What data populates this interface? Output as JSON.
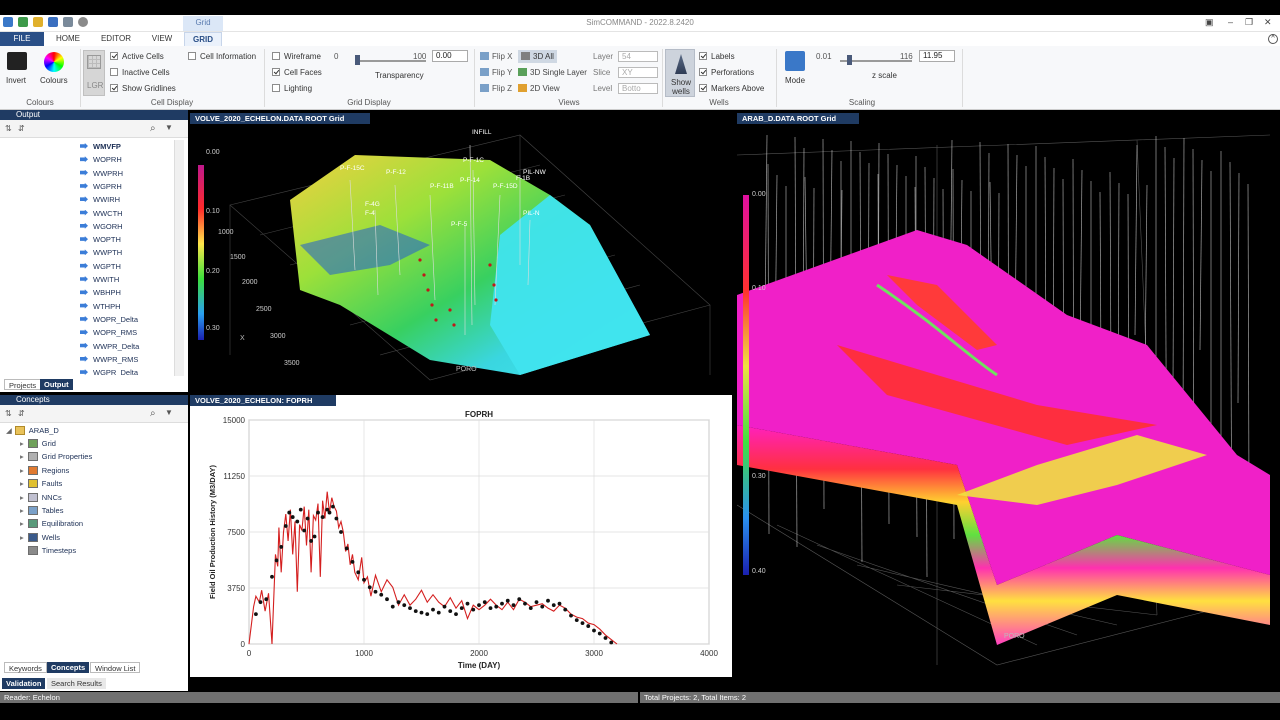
{
  "window": {
    "title": "SimCOMMAND - 2022.8.2420",
    "context_tab": "Grid"
  },
  "tabs": [
    "FILE",
    "HOME",
    "EDITOR",
    "VIEW",
    "GRID"
  ],
  "ribbon": {
    "colours": {
      "invert": "Invert",
      "colours": "Colours",
      "group": "Colours"
    },
    "cell_display": {
      "lgr": "LGR",
      "active": "Active Cells",
      "inactive": "Inactive Cells",
      "gridlines": "Show Gridlines",
      "info": "Cell Information",
      "group": "Cell Display"
    },
    "grid_display": {
      "wireframe": "Wireframe",
      "faces": "Cell Faces",
      "lighting": "Lighting",
      "min": "0",
      "max": "100",
      "value": "0.00",
      "transparency": "Transparency",
      "group": "Grid Display"
    },
    "views": {
      "flipx": "Flip X",
      "flipy": "Flip Y",
      "flipz": "Flip Z",
      "all3d": "3D All",
      "single3d": "3D Single Layer",
      "view2d": "2D View",
      "layer": "Layer",
      "slice": "Slice",
      "level": "Level",
      "layer_val": "54",
      "slice_val": "XY",
      "level_val": "Botto",
      "group": "Views"
    },
    "wells": {
      "show": "Show wells",
      "labels": "Labels",
      "perfs": "Perforations",
      "markers": "Markers Above",
      "group": "Wells"
    },
    "scaling": {
      "mode": "Mode",
      "min": "0.01",
      "max": "116",
      "zscale": "z scale",
      "value": "11.95",
      "group": "Scaling"
    }
  },
  "output_panel": {
    "title": "Output",
    "items": [
      "WMVFP",
      "WOPRH",
      "WWPRH",
      "WGPRH",
      "WWIRH",
      "WWCTH",
      "WGORH",
      "WOPTH",
      "WWPTH",
      "WGPTH",
      "WWITH",
      "WBHPH",
      "WTHPH",
      "WOPR_Delta",
      "WOPR_RMS",
      "WWPR_Delta",
      "WWPR_RMS",
      "WGPR_Delta"
    ],
    "tabs": [
      "Projects",
      "Output"
    ]
  },
  "concepts_panel": {
    "title": "Concepts",
    "root": "ARAB_D",
    "items": [
      "Grid",
      "Grid Properties",
      "Regions",
      "Faults",
      "NNCs",
      "Tables",
      "Equilibration",
      "Wells",
      "Timesteps"
    ],
    "tabs": [
      "Keywords",
      "Concepts",
      "Window List"
    ],
    "tabs2": [
      "Validation",
      "Search Results"
    ]
  },
  "view1": {
    "title": "VOLVE_2020_ECHELON.DATA ROOT Grid",
    "scale": [
      "0.00",
      "0.10",
      "0.20",
      "0.30"
    ],
    "depths": [
      "1000",
      "1500",
      "2000",
      "2500",
      "3000",
      "3500"
    ],
    "axis_x": "X",
    "prop": "PORO",
    "wells": [
      "INFILL",
      "P-F-15C",
      "P-F-1C",
      "P-F-12",
      "P-F-11B",
      "P-F-14",
      "P-F-15D",
      "PIL-NW",
      "F-1B",
      "PIL-N",
      "P-F-5",
      "F-4G",
      "F-4"
    ]
  },
  "view2": {
    "title": "VOLVE_2020_ECHELON: FOPRH"
  },
  "view3": {
    "title": "ARAB_D.DATA ROOT Grid",
    "scale": [
      "0.00",
      "0.10",
      "0.30",
      "0.40"
    ],
    "prop": "PORO"
  },
  "status": {
    "left": "Reader: Echelon",
    "right": "Total Projects: 2, Total Items: 2"
  },
  "chart_data": {
    "type": "line",
    "title": "FOPRH",
    "xlabel": "Time (DAY)",
    "ylabel": "Field Oil Production History (M3/DAY)",
    "xlim": [
      0,
      4000
    ],
    "ylim": [
      0,
      15000
    ],
    "xticks": [
      0,
      1000,
      2000,
      3000,
      4000
    ],
    "yticks": [
      0,
      3750,
      7500,
      11250,
      15000
    ],
    "series": [
      {
        "style": "line",
        "color": "#d41f1f",
        "x": [
          0,
          40,
          60,
          90,
          110,
          140,
          170,
          200,
          230,
          250,
          260,
          280,
          300,
          320,
          340,
          360,
          380,
          400,
          420,
          440,
          460,
          480,
          500,
          520,
          540,
          560,
          580,
          600,
          620,
          640,
          660,
          680,
          700,
          720,
          740,
          760,
          780,
          800,
          820,
          840,
          860,
          880,
          900,
          920,
          950,
          980,
          1000,
          1030,
          1060,
          1100,
          1150,
          1200,
          1250,
          1300,
          1350,
          1400,
          1450,
          1500,
          1550,
          1600,
          1650,
          1700,
          1750,
          1800,
          1850,
          1900,
          1950,
          2000,
          2050,
          2100,
          2150,
          2200,
          2250,
          2300,
          2350,
          2400,
          2450,
          2500,
          2550,
          2600,
          2650,
          2700,
          2750,
          2800,
          2850,
          2900,
          2950,
          3000,
          3050,
          3100,
          3150,
          3200
        ],
        "y": [
          0,
          2500,
          3200,
          2800,
          3600,
          2200,
          3400,
          0,
          6000,
          5200,
          7800,
          4800,
          7500,
          8700,
          6900,
          9000,
          6000,
          8200,
          3500,
          8000,
          7600,
          9200,
          6600,
          9000,
          4800,
          8600,
          8300,
          9400,
          4500,
          9600,
          8400,
          10200,
          8800,
          9800,
          9200,
          8900,
          7800,
          8200,
          7500,
          6200,
          6700,
          5300,
          6000,
          4800,
          4300,
          5800,
          4100,
          4500,
          3200,
          4600,
          3500,
          4300,
          3800,
          2600,
          3300,
          2600,
          3000,
          3600,
          2800,
          3300,
          2800,
          2500,
          3100,
          2400,
          2900,
          1700,
          2600,
          2300,
          2600,
          3000,
          2600,
          2300,
          2800,
          2300,
          3000,
          2800,
          2500,
          2600,
          2700,
          2400,
          2200,
          2600,
          2400,
          2000,
          1800,
          1700,
          1400,
          1300,
          1000,
          600,
          300,
          0
        ]
      },
      {
        "style": "markers",
        "color": "#111111",
        "x": [
          60,
          100,
          150,
          200,
          240,
          280,
          320,
          350,
          380,
          420,
          450,
          480,
          510,
          540,
          570,
          600,
          640,
          680,
          700,
          730,
          760,
          800,
          850,
          900,
          950,
          1000,
          1050,
          1100,
          1150,
          1200,
          1250,
          1300,
          1350,
          1400,
          1450,
          1500,
          1550,
          1600,
          1650,
          1700,
          1750,
          1800,
          1850,
          1900,
          1950,
          2000,
          2050,
          2100,
          2150,
          2200,
          2250,
          2300,
          2350,
          2400,
          2450,
          2500,
          2550,
          2600,
          2650,
          2700,
          2750,
          2800,
          2850,
          2900,
          2950,
          3000,
          3050,
          3100,
          3150
        ],
        "y": [
          2000,
          2800,
          3000,
          4500,
          5600,
          6500,
          7900,
          8800,
          8500,
          8200,
          9000,
          7600,
          8400,
          6900,
          7200,
          8800,
          8500,
          9000,
          8800,
          9200,
          8400,
          7500,
          6400,
          5500,
          4800,
          4300,
          3800,
          3500,
          3300,
          3000,
          2500,
          2800,
          2600,
          2400,
          2200,
          2100,
          2000,
          2300,
          2100,
          2500,
          2200,
          2000,
          2400,
          2700,
          2300,
          2600,
          2800,
          2400,
          2500,
          2700,
          2900,
          2600,
          3000,
          2700,
          2400,
          2800,
          2500,
          2900,
          2600,
          2700,
          2300,
          1900,
          1600,
          1400,
          1200,
          900,
          700,
          400,
          100
        ]
      }
    ]
  }
}
